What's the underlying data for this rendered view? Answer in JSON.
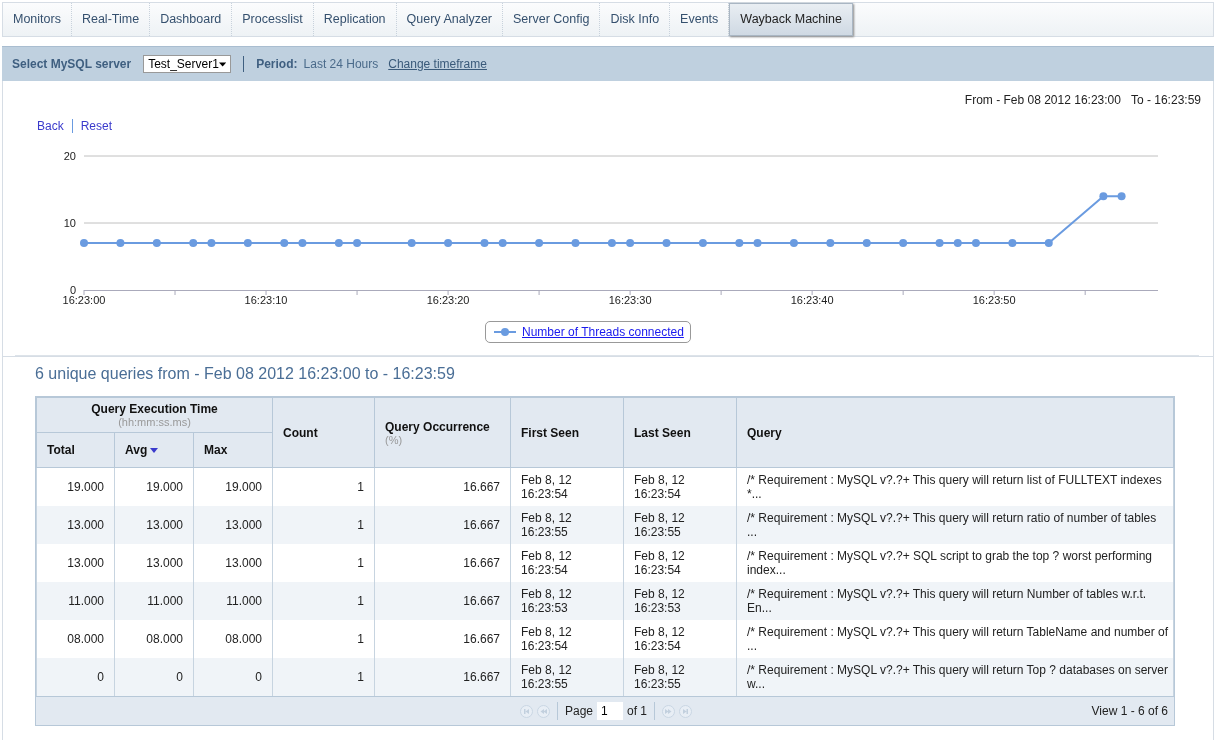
{
  "tabs": [
    {
      "label": "Monitors",
      "selected": false
    },
    {
      "label": "Real-Time",
      "selected": false
    },
    {
      "label": "Dashboard",
      "selected": false
    },
    {
      "label": "Processlist",
      "selected": false
    },
    {
      "label": "Replication",
      "selected": false
    },
    {
      "label": "Query Analyzer",
      "selected": false
    },
    {
      "label": "Server Config",
      "selected": false
    },
    {
      "label": "Disk Info",
      "selected": false
    },
    {
      "label": "Events",
      "selected": false
    },
    {
      "label": "Wayback Machine",
      "selected": true
    }
  ],
  "filter_bar": {
    "server_label": "Select MySQL server",
    "server_value": "Test_Server1",
    "period_label": "Period:",
    "period_value": "Last 24 Hours",
    "change_link": "Change timeframe"
  },
  "chart_panel": {
    "links": [
      "Back",
      "Reset"
    ],
    "from_text": "From - Feb 08 2012 16:23:00",
    "to_text": "To - 16:23:59",
    "chart_data": {
      "type": "line",
      "x": [
        58980,
        58982,
        58984,
        58986,
        58987,
        58989,
        58991,
        58992,
        58994,
        58995,
        58998,
        59000,
        59002,
        59003,
        59005,
        59007,
        59009,
        59010,
        59012,
        59014,
        59016,
        59017,
        59019,
        59021,
        59023,
        59025,
        59027,
        59028,
        59029,
        59031,
        59033,
        59036,
        59037
      ],
      "series": [
        {
          "name": "Number of Threads connected",
          "color": "#6a9be0",
          "marker": "circle",
          "values": [
            7,
            7,
            7,
            7,
            7,
            7,
            7,
            7,
            7,
            7,
            7,
            7,
            7,
            7,
            7,
            7,
            7,
            7,
            7,
            7,
            7,
            7,
            7,
            7,
            7,
            7,
            7,
            7,
            7,
            7,
            7,
            14,
            14
          ]
        }
      ],
      "xlim": [
        58980,
        59039
      ],
      "ylim": [
        0,
        20
      ],
      "xticks": [
        {
          "value": 58980,
          "label": "16:23:00"
        },
        {
          "value": 58990,
          "label": "16:23:10"
        },
        {
          "value": 59000,
          "label": "16:23:20"
        },
        {
          "value": 59010,
          "label": "16:23:30"
        },
        {
          "value": 59020,
          "label": "16:23:40"
        },
        {
          "value": 59030,
          "label": "16:23:50"
        }
      ],
      "yticks": [
        0,
        10,
        20
      ]
    }
  },
  "summary_title": "6 unique queries from - Feb 08 2012 16:23:00 to - 16:23:59",
  "table": {
    "group_header": {
      "title": "Query Execution Time",
      "subtitle": "(hh:mm:ss.ms)"
    },
    "columns": [
      {
        "label": "Total",
        "sorted": false
      },
      {
        "label": "Avg",
        "sorted": true
      },
      {
        "label": "Max",
        "sorted": false
      },
      {
        "label": "Count",
        "sorted": false
      },
      {
        "label": "Query Occurrence",
        "subtitle": "(%)",
        "sorted": false
      },
      {
        "label": "First Seen",
        "sorted": false
      },
      {
        "label": "Last Seen",
        "sorted": false
      },
      {
        "label": "Query",
        "sorted": false
      }
    ],
    "rows": [
      [
        "19.000",
        "19.000",
        "19.000",
        "1",
        "16.667",
        "Feb 8, 12 16:23:54",
        "Feb 8, 12 16:23:54",
        "/* Requirement : MySQL v?.?+ This query will return list of FULLTEXT indexes *..."
      ],
      [
        "13.000",
        "13.000",
        "13.000",
        "1",
        "16.667",
        "Feb 8, 12 16:23:55",
        "Feb 8, 12 16:23:55",
        "/* Requirement : MySQL v?.?+ This query will return ratio of number of tables ..."
      ],
      [
        "13.000",
        "13.000",
        "13.000",
        "1",
        "16.667",
        "Feb 8, 12 16:23:54",
        "Feb 8, 12 16:23:54",
        "/* Requirement : MySQL v?.?+ SQL script to grab the top ? worst performing index..."
      ],
      [
        "11.000",
        "11.000",
        "11.000",
        "1",
        "16.667",
        "Feb 8, 12 16:23:53",
        "Feb 8, 12 16:23:53",
        "/* Requirement : MySQL v?.?+ This query will return Number of tables w.r.t. En..."
      ],
      [
        "08.000",
        "08.000",
        "08.000",
        "1",
        "16.667",
        "Feb 8, 12 16:23:54",
        "Feb 8, 12 16:23:54",
        "/* Requirement : MySQL v?.?+ This query will return TableName and number of ..."
      ],
      [
        "0",
        "0",
        "0",
        "1",
        "16.667",
        "Feb 8, 12 16:23:55",
        "Feb 8, 12 16:23:55",
        "/* Requirement : MySQL v?.?+ This query will return Top ? databases on server w..."
      ]
    ],
    "pager": {
      "page_label": "Page",
      "page_value": "1",
      "of_text": "of 1",
      "view_text": "View 1 - 6 of 6"
    }
  }
}
